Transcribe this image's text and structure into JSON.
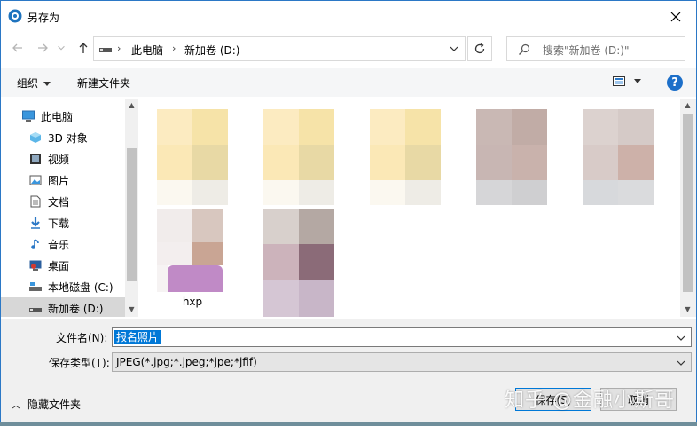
{
  "window": {
    "title": "另存为",
    "close_icon": "close-icon"
  },
  "nav": {
    "back_icon": "arrow-left-icon",
    "forward_icon": "arrow-right-icon",
    "recent_icon": "chevron-down-icon",
    "up_icon": "arrow-up-icon",
    "breadcrumb": [
      "此电脑",
      "新加卷 (D:)"
    ],
    "refresh_icon": "refresh-icon",
    "search_placeholder": "搜索\"新加卷 (D:)\""
  },
  "toolbar": {
    "organize_label": "组织",
    "new_folder_label": "新建文件夹",
    "view_icon": "view-icon",
    "help_label": "?"
  },
  "tree": {
    "items": [
      {
        "label": "此电脑",
        "icon": "computer-icon"
      },
      {
        "label": "3D 对象",
        "icon": "3d-objects-icon"
      },
      {
        "label": "视频",
        "icon": "video-icon"
      },
      {
        "label": "图片",
        "icon": "pictures-icon"
      },
      {
        "label": "文档",
        "icon": "documents-icon"
      },
      {
        "label": "下载",
        "icon": "download-icon"
      },
      {
        "label": "音乐",
        "icon": "music-icon"
      },
      {
        "label": "桌面",
        "icon": "desktop-icon"
      },
      {
        "label": "本地磁盘 (C:)",
        "icon": "drive-c-icon"
      },
      {
        "label": "新加卷 (D:)",
        "icon": "drive-d-icon"
      }
    ]
  },
  "files": {
    "labeled_item": "hxp"
  },
  "fields": {
    "filename_label": "文件名(N):",
    "filename_value": "报名照片",
    "filetype_label": "保存类型(T):",
    "filetype_value": "JPEG(*.jpg;*.jpeg;*jpe;*jfif)"
  },
  "footer": {
    "hide_folders_label": "隐藏文件夹",
    "save_label": "保存(S)",
    "cancel_label": "取消",
    "watermark": "知乎 @金融小斯哥"
  },
  "colors": {
    "accent": "#0078d7",
    "help": "#1c6fc9"
  }
}
